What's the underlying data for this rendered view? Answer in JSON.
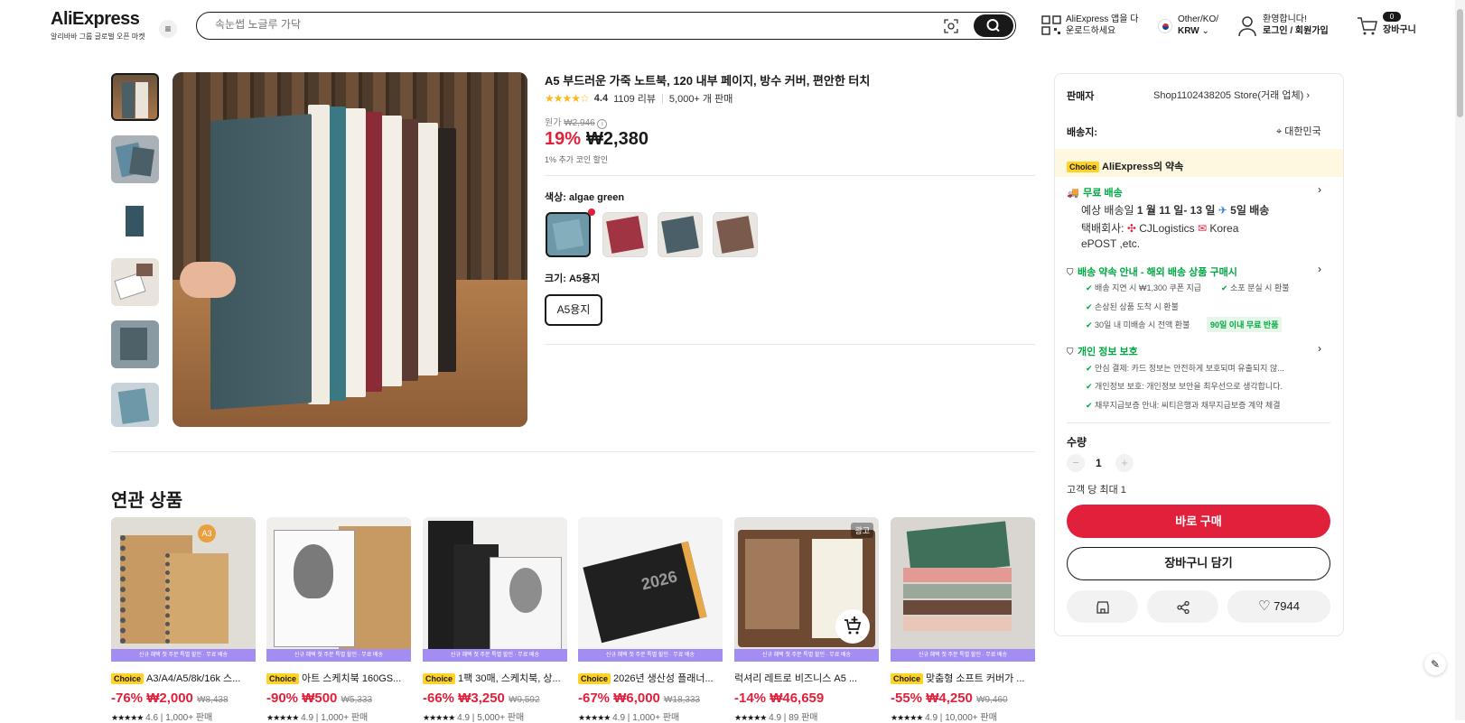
{
  "header": {
    "logo": "AliExpress",
    "logo_tag": "알리바바 그룹 글로벌 오픈 마켓",
    "search_placeholder": "속눈썹 노글루 가닥",
    "app_line1": "AliExpress 앱을 다",
    "app_line2": "운로드하세요",
    "region_line1": "Other/KO/",
    "region_line2": "KRW",
    "account_line1": "환영합니다!",
    "account_line2": "로그인 / 회원가입",
    "cart_label": "장바구니",
    "cart_count": "0"
  },
  "product": {
    "title": "A5 부드러운 가죽 노트북, 120 내부 페이지, 방수 커버, 편안한 터치",
    "rating": "4.4",
    "reviews": "1109 리뷰",
    "sold": "5,000+ 개 판매",
    "orig_label": "원가",
    "orig_price": "₩2,946",
    "discount": "19%",
    "price": "₩2,380",
    "coin_note": "1% 추가 코인 할인",
    "color_label": "색상: algae green",
    "size_label": "크기: A5용지",
    "size_option": "A5용지",
    "swatch_colors": [
      "#6d98a8",
      "#a03443",
      "#4a5f67",
      "#7a5a4c"
    ]
  },
  "related": {
    "title": "연관 상품",
    "strip": "신규 혜택 첫 주문 특별 할인 · 무료 배송",
    "items": [
      {
        "choice": "Choice",
        "name": "A3/A4/A5/8k/16k 스...",
        "discount": "-76%",
        "price": "₩2,000",
        "orig": "₩8,438",
        "rating": "4.6",
        "sold": "1,000+ 판매"
      },
      {
        "choice": "Choice",
        "name": "아트 스케치북 160GS...",
        "discount": "-90%",
        "price": "₩500",
        "orig": "₩5,333",
        "rating": "4.9",
        "sold": "1,000+ 판매"
      },
      {
        "choice": "Choice",
        "name": "1팩 30매, 스케치북, 상...",
        "discount": "-66%",
        "price": "₩3,250",
        "orig": "₩9,592",
        "rating": "4.9",
        "sold": "5,000+ 판매"
      },
      {
        "choice": "Choice",
        "name": "2026년 생산성 플래너...",
        "discount": "-67%",
        "price": "₩6,000",
        "orig": "₩18,333",
        "rating": "4.9",
        "sold": "1,000+ 판매"
      },
      {
        "choice": "",
        "name": "럭셔리 레트로 비즈니스 A5 ...",
        "discount": "-14%",
        "price": "₩46,659",
        "orig": "",
        "rating": "4.9",
        "sold": "89 판매",
        "ad": "광고"
      },
      {
        "choice": "Choice",
        "name": "맞춤형 소프트 커버가 ...",
        "discount": "-55%",
        "price": "₩4,250",
        "orig": "₩9,460",
        "rating": "4.9",
        "sold": "10,000+ 판매"
      }
    ]
  },
  "panel": {
    "seller_label": "판매자",
    "seller_name": "Shop1102438205 Store(거래 업체)",
    "ship_label": "배송지:",
    "ship_dest": "대한민국",
    "choice_badge": "Choice",
    "choice_promise": "AliExpress의 약속",
    "free_ship": "무료 배송",
    "eta_pre": "예상 배송일",
    "eta_dates": "1 월 11 일- 13 일",
    "eta_days": "5일 배송",
    "courier_label": "택배회사:",
    "courier1": "CJLogistics",
    "courier2": "Korea",
    "courier3": "ePOST ,etc.",
    "guarantee_title": "배송 약속 안내 - 해외 배송 상품 구매시",
    "guarantee_items": [
      "배송 지연 시 ₩1,300 쿠폰 지급",
      "소포 분실 시 환불",
      "손상된 상품 도착 시 환불",
      "30일 내 미배송 시 전액 환불"
    ],
    "return_badge": "90일 이내 무료 반품",
    "privacy_title": "개인 정보 보호",
    "privacy_items": [
      "안심 결제: 카드 정보는 안전하게 보호되며 유출되지 않...",
      "개인정보 보호: 개인정보 보안을 최우선으로 생각합니다.",
      "채무지급보증 안내: 씨티은행과 채무지급보증 계약 체결"
    ],
    "qty_label": "수량",
    "qty_value": "1",
    "qty_limit": "고객 당 최대 1",
    "buy_now": "바로 구매",
    "add_cart": "장바구니 담기",
    "wish_count": "7944"
  },
  "colors": {
    "accent": "#e1203c",
    "choice": "#ffd224",
    "green": "#00a843"
  }
}
